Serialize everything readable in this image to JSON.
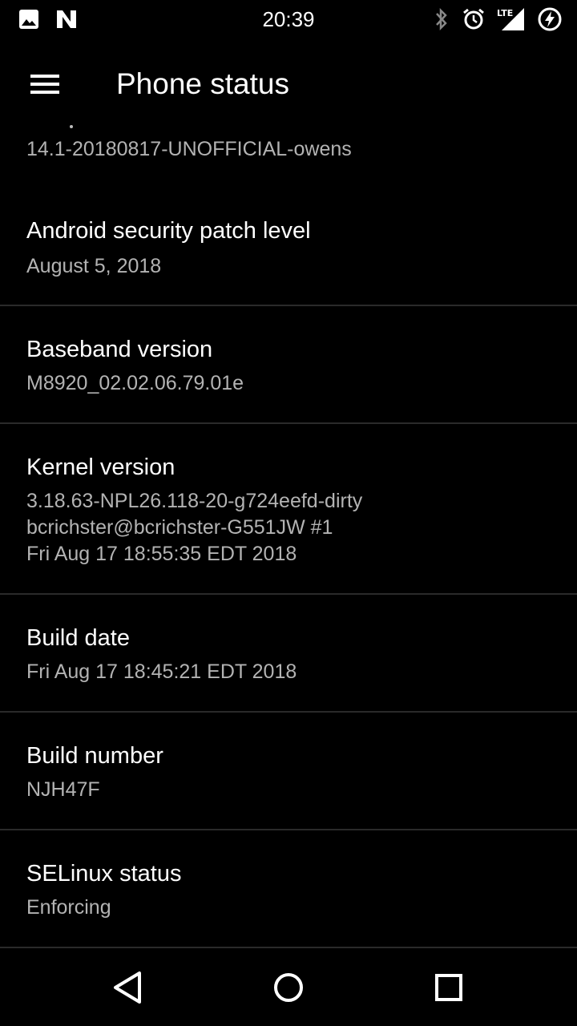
{
  "status_bar": {
    "time": "20:39",
    "lte_label": "LTE",
    "left_icons": [
      "image-icon",
      "n-icon"
    ],
    "right_icons": [
      "bluetooth-icon",
      "alarm-icon",
      "lte-signal-icon",
      "battery-charging-icon"
    ]
  },
  "app_bar": {
    "title": "Phone status"
  },
  "partial_item": {
    "value": "14.1-20180817-UNOFFICIAL-owens"
  },
  "items": [
    {
      "title": "Android security patch level",
      "summary_lines": [
        "August 5, 2018"
      ]
    },
    {
      "title": "Baseband version",
      "summary_lines": [
        "M8920_02.02.06.79.01e"
      ]
    },
    {
      "title": "Kernel version",
      "summary_lines": [
        "3.18.63-NPL26.118-20-g724eefd-dirty",
        "bcrichster@bcrichster-G551JW #1",
        "Fri Aug 17 18:55:35 EDT 2018"
      ]
    },
    {
      "title": "Build date",
      "summary_lines": [
        "Fri Aug 17 18:45:21 EDT 2018"
      ]
    },
    {
      "title": "Build number",
      "summary_lines": [
        "NJH47F"
      ]
    },
    {
      "title": "SELinux status",
      "summary_lines": [
        "Enforcing"
      ]
    }
  ],
  "nav_bar": {
    "icons": [
      "back-icon",
      "home-icon",
      "recents-icon"
    ]
  },
  "colors": {
    "background": "#000000",
    "primary_text": "#ffffff",
    "secondary_text": "#b3b3b3",
    "divider": "#2a2a2a"
  }
}
